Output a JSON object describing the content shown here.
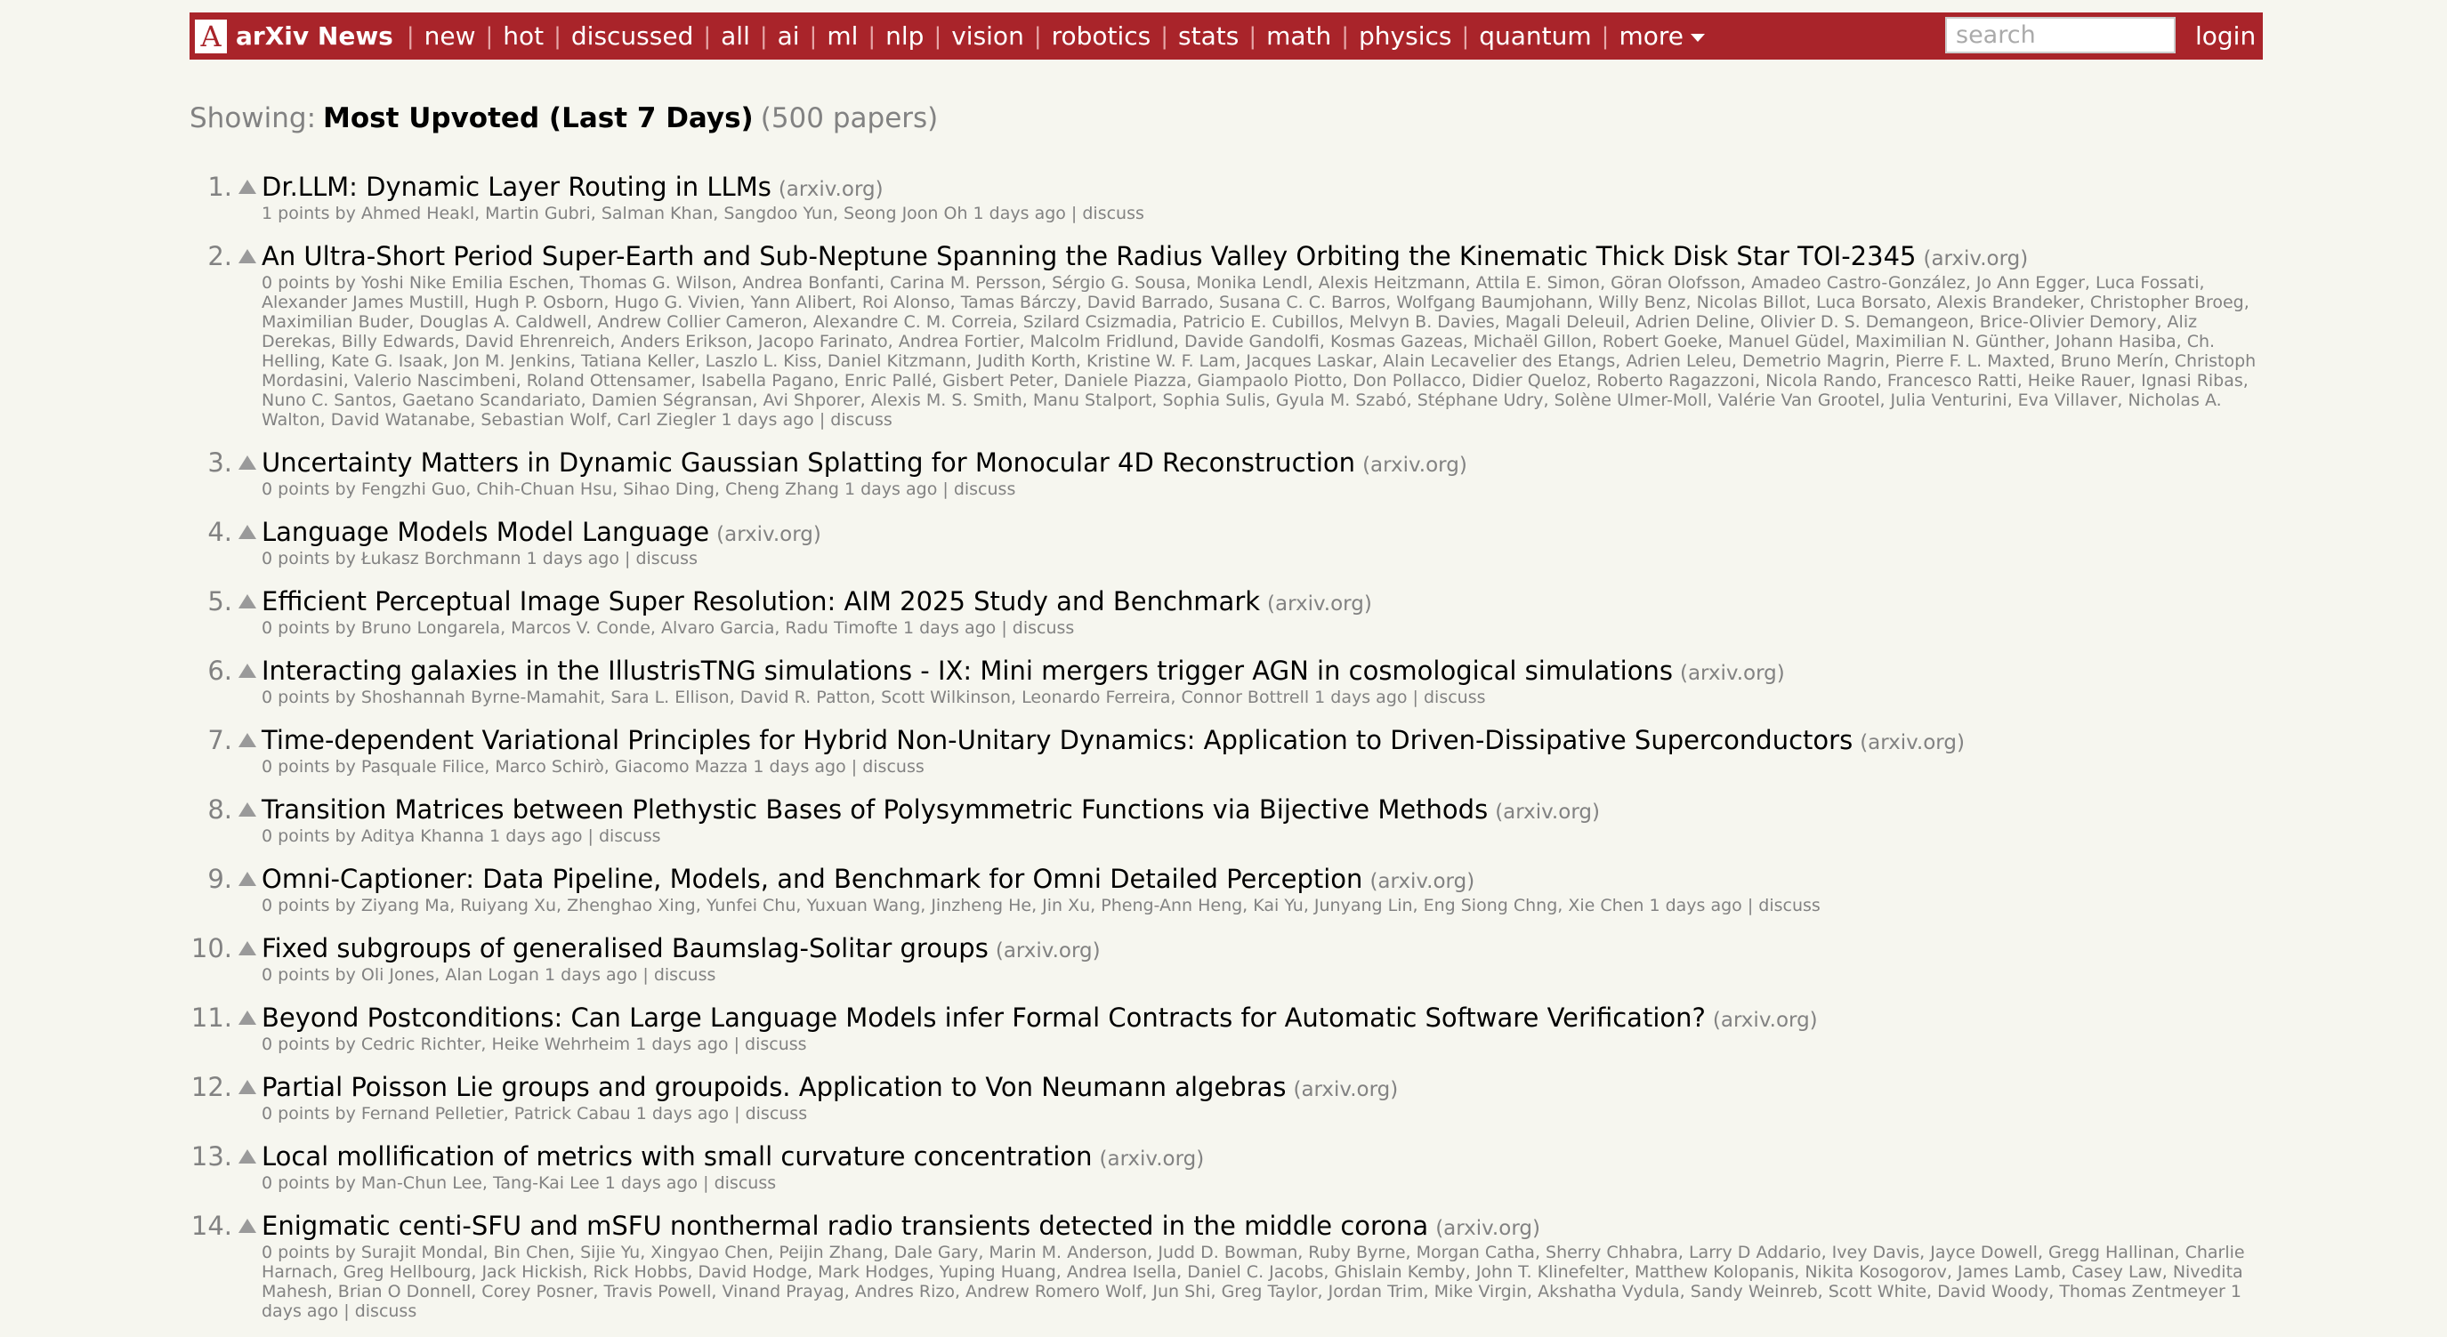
{
  "header": {
    "logo_letter": "A",
    "brand": "arXiv News",
    "nav": [
      "new",
      "hot",
      "discussed",
      "all",
      "ai",
      "ml",
      "nlp",
      "vision",
      "robotics",
      "stats",
      "math",
      "physics",
      "quantum",
      "more"
    ],
    "search_placeholder": "search",
    "login": "login"
  },
  "showing": {
    "prefix": "Showing:",
    "label": "Most Upvoted (Last 7 Days)",
    "count": "(500 papers)"
  },
  "items": [
    {
      "rank": "1.",
      "title": "Dr.LLM: Dynamic Layer Routing in LLMs",
      "domain": "(arxiv.org)",
      "meta": "1 points by Ahmed Heakl, Martin Gubri, Salman Khan, Sangdoo Yun, Seong Joon Oh 1 days ago | ",
      "discuss": "discuss"
    },
    {
      "rank": "2.",
      "title": "An Ultra-Short Period Super-Earth and Sub-Neptune Spanning the Radius Valley Orbiting the Kinematic Thick Disk Star TOI-2345",
      "domain": "(arxiv.org)",
      "meta": "0 points by Yoshi Nike Emilia Eschen, Thomas G. Wilson, Andrea Bonfanti, Carina M. Persson, Sérgio G. Sousa, Monika Lendl, Alexis Heitzmann, Attila E. Simon, Göran Olofsson, Amadeo Castro-González, Jo Ann Egger, Luca Fossati, Alexander James Mustill, Hugh P. Osborn, Hugo G. Vivien, Yann Alibert, Roi Alonso, Tamas Bárczy, David Barrado, Susana C. C. Barros, Wolfgang Baumjohann, Willy Benz, Nicolas Billot, Luca Borsato, Alexis Brandeker, Christopher Broeg, Maximilian Buder, Douglas A. Caldwell, Andrew Collier Cameron, Alexandre C. M. Correia, Szilard Csizmadia, Patricio E. Cubillos, Melvyn B. Davies, Magali Deleuil, Adrien Deline, Olivier D. S. Demangeon, Brice-Olivier Demory, Aliz Derekas, Billy Edwards, David Ehrenreich, Anders Erikson, Jacopo Farinato, Andrea Fortier, Malcolm Fridlund, Davide Gandolfi, Kosmas Gazeas, Michaël Gillon, Robert Goeke, Manuel Güdel, Maximilian N. Günther, Johann Hasiba, Ch. Helling, Kate G. Isaak, Jon M. Jenkins, Tatiana Keller, Laszlo L. Kiss, Daniel Kitzmann, Judith Korth, Kristine W. F. Lam, Jacques Laskar, Alain Lecavelier des Etangs, Adrien Leleu, Demetrio Magrin, Pierre F. L. Maxted, Bruno Merín, Christoph Mordasini, Valerio Nascimbeni, Roland Ottensamer, Isabella Pagano, Enric Pallé, Gisbert Peter, Daniele Piazza, Giampaolo Piotto, Don Pollacco, Didier Queloz, Roberto Ragazzoni, Nicola Rando, Francesco Ratti, Heike Rauer, Ignasi Ribas, Nuno C. Santos, Gaetano Scandariato, Damien Ségransan, Avi Shporer, Alexis M. S. Smith, Manu Stalport, Sophia Sulis, Gyula M. Szabó, Stéphane Udry, Solène Ulmer-Moll, Valérie Van Grootel, Julia Venturini, Eva Villaver, Nicholas A. Walton, David Watanabe, Sebastian Wolf, Carl Ziegler 1 days ago | ",
      "discuss": "discuss"
    },
    {
      "rank": "3.",
      "title": "Uncertainty Matters in Dynamic Gaussian Splatting for Monocular 4D Reconstruction",
      "domain": "(arxiv.org)",
      "meta": "0 points by Fengzhi Guo, Chih-Chuan Hsu, Sihao Ding, Cheng Zhang 1 days ago | ",
      "discuss": "discuss"
    },
    {
      "rank": "4.",
      "title": "Language Models Model Language",
      "domain": "(arxiv.org)",
      "meta": "0 points by Łukasz Borchmann 1 days ago | ",
      "discuss": "discuss"
    },
    {
      "rank": "5.",
      "title": "Efficient Perceptual Image Super Resolution: AIM 2025 Study and Benchmark",
      "domain": "(arxiv.org)",
      "meta": "0 points by Bruno Longarela, Marcos V. Conde, Alvaro Garcia, Radu Timofte 1 days ago | ",
      "discuss": "discuss"
    },
    {
      "rank": "6.",
      "title": "Interacting galaxies in the IllustrisTNG simulations - IX: Mini mergers trigger AGN in cosmological simulations",
      "domain": "(arxiv.org)",
      "meta": "0 points by Shoshannah Byrne-Mamahit, Sara L. Ellison, David R. Patton, Scott Wilkinson, Leonardo Ferreira, Connor Bottrell 1 days ago | ",
      "discuss": "discuss"
    },
    {
      "rank": "7.",
      "title": "Time-dependent Variational Principles for Hybrid Non-Unitary Dynamics: Application to Driven-Dissipative Superconductors",
      "domain": "(arxiv.org)",
      "meta": "0 points by Pasquale Filice, Marco Schirò, Giacomo Mazza 1 days ago | ",
      "discuss": "discuss"
    },
    {
      "rank": "8.",
      "title": "Transition Matrices between Plethystic Bases of Polysymmetric Functions via Bijective Methods",
      "domain": "(arxiv.org)",
      "meta": "0 points by Aditya Khanna 1 days ago | ",
      "discuss": "discuss"
    },
    {
      "rank": "9.",
      "title": "Omni-Captioner: Data Pipeline, Models, and Benchmark for Omni Detailed Perception",
      "domain": "(arxiv.org)",
      "meta": "0 points by Ziyang Ma, Ruiyang Xu, Zhenghao Xing, Yunfei Chu, Yuxuan Wang, Jinzheng He, Jin Xu, Pheng-Ann Heng, Kai Yu, Junyang Lin, Eng Siong Chng, Xie Chen 1 days ago | ",
      "discuss": "discuss"
    },
    {
      "rank": "10.",
      "title": "Fixed subgroups of generalised Baumslag-Solitar groups",
      "domain": "(arxiv.org)",
      "meta": "0 points by Oli Jones, Alan Logan 1 days ago | ",
      "discuss": "discuss"
    },
    {
      "rank": "11.",
      "title": "Beyond Postconditions: Can Large Language Models infer Formal Contracts for Automatic Software Verification?",
      "domain": "(arxiv.org)",
      "meta": "0 points by Cedric Richter, Heike Wehrheim 1 days ago | ",
      "discuss": "discuss"
    },
    {
      "rank": "12.",
      "title": "Partial Poisson Lie groups and groupoids. Application to Von Neumann algebras",
      "domain": "(arxiv.org)",
      "meta": "0 points by Fernand Pelletier, Patrick Cabau 1 days ago | ",
      "discuss": "discuss"
    },
    {
      "rank": "13.",
      "title": "Local mollification of metrics with small curvature concentration",
      "domain": "(arxiv.org)",
      "meta": "0 points by Man-Chun Lee, Tang-Kai Lee 1 days ago | ",
      "discuss": "discuss"
    },
    {
      "rank": "14.",
      "title": "Enigmatic centi-SFU and mSFU nonthermal radio transients detected in the middle corona",
      "domain": "(arxiv.org)",
      "meta": "0 points by Surajit Mondal, Bin Chen, Sijie Yu, Xingyao Chen, Peijin Zhang, Dale Gary, Marin M. Anderson, Judd D. Bowman, Ruby Byrne, Morgan Catha, Sherry Chhabra, Larry D Addario, Ivey Davis, Jayce Dowell, Gregg Hallinan, Charlie Harnach, Greg Hellbourg, Jack Hickish, Rick Hobbs, David Hodge, Mark Hodges, Yuping Huang, Andrea Isella, Daniel C. Jacobs, Ghislain Kemby, John T. Klinefelter, Matthew Kolopanis, Nikita Kosogorov, James Lamb, Casey Law, Nivedita Mahesh, Brian O Donnell, Corey Posner, Travis Powell, Vinand Prayag, Andres Rizo, Andrew Romero Wolf, Jun Shi, Greg Taylor, Jordan Trim, Mike Virgin, Akshatha Vydula, Sandy Weinreb, Scott White, David Woody, Thomas Zentmeyer 1 days ago | ",
      "discuss": "discuss"
    }
  ]
}
